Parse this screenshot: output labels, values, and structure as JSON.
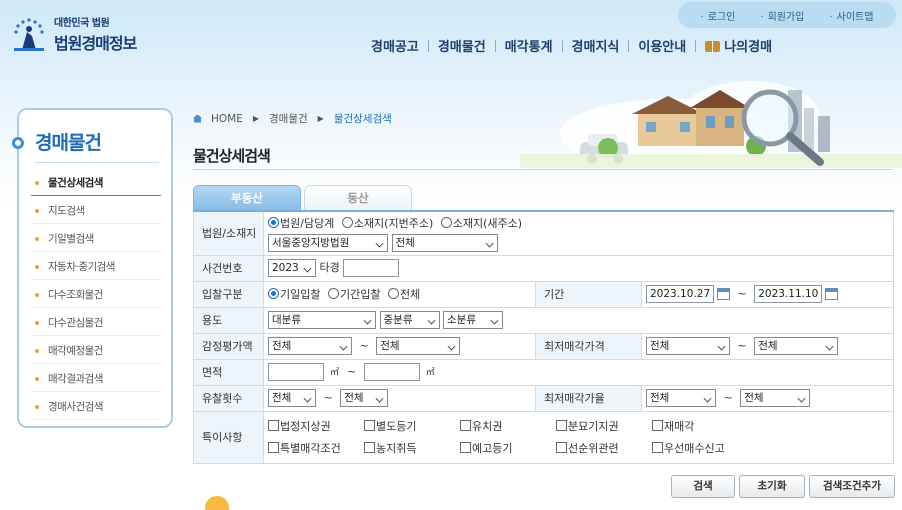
{
  "header": {
    "logo_sub": "대한민국 법원",
    "logo_main": "법원경매정보",
    "util_links": [
      "로그인",
      "회원가입",
      "사이트맵"
    ],
    "gnb": [
      "경매공고",
      "경매물건",
      "매각통계",
      "경매지식",
      "이용안내",
      "나의경매"
    ]
  },
  "sidebar": {
    "title": "경매물건",
    "items": [
      {
        "label": "물건상세검색",
        "active": true
      },
      {
        "label": "지도검색"
      },
      {
        "label": "기일별검색"
      },
      {
        "label": "자동차·중기검색"
      },
      {
        "label": "다수조회물건"
      },
      {
        "label": "다수관심물건"
      },
      {
        "label": "매각예정물건"
      },
      {
        "label": "매각결과검색"
      },
      {
        "label": "경매사건검색"
      }
    ]
  },
  "breadcrumb": [
    "HOME",
    "경매물건",
    "물건상세검색"
  ],
  "page_title": "물건상세검색",
  "tabs": [
    {
      "label": "부동산",
      "active": true
    },
    {
      "label": "동산",
      "active": false
    }
  ],
  "form": {
    "court": {
      "label": "법원/소재지",
      "radios": [
        {
          "label": "법원/담당계",
          "checked": true
        },
        {
          "label": "소재지(지번주소)",
          "checked": false
        },
        {
          "label": "소재지(새주소)",
          "checked": false
        }
      ],
      "court_select": "서울중앙지방법원",
      "dept_select": "전체"
    },
    "case": {
      "label": "사건번호",
      "year": "2023",
      "type_label": "타경",
      "number": ""
    },
    "bid": {
      "label": "입찰구분",
      "radios": [
        {
          "label": "기일입찰",
          "checked": true
        },
        {
          "label": "기간입찰",
          "checked": false
        },
        {
          "label": "전체",
          "checked": false
        }
      ]
    },
    "period": {
      "label": "기간",
      "from": "2023.10.27",
      "to": "2023.11.10"
    },
    "use": {
      "label": "용도",
      "large": "대분류",
      "mid": "중분류",
      "small": "소분류"
    },
    "appraisal": {
      "label": "감정평가액",
      "from": "전체",
      "to": "전체"
    },
    "min_price": {
      "label": "최저매각가격",
      "from": "전체",
      "to": "전체"
    },
    "area": {
      "label": "면적",
      "unit": "㎡",
      "from": "",
      "to": ""
    },
    "fail_count": {
      "label": "유찰횟수",
      "from": "전체",
      "to": "전체"
    },
    "min_rate": {
      "label": "최저매각가율",
      "from": "전체",
      "to": "전체"
    },
    "special": {
      "label": "특이사항",
      "options": [
        "법정지상권",
        "별도등기",
        "유치권",
        "분묘기지권",
        "재매각",
        "특별매각조건",
        "농지취득",
        "예고등기",
        "선순위관련",
        "우선매수신고"
      ]
    }
  },
  "buttons": {
    "search": "검색",
    "reset": "초기화",
    "add_condition": "검색조건추가"
  },
  "colors": {
    "primary": "#1b6cb8",
    "nav": "#1f3f6e",
    "accent": "#f0a030",
    "tab_active": "#86bde6"
  }
}
